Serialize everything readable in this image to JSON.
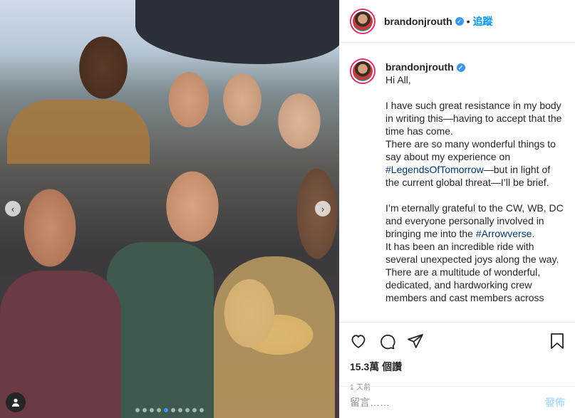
{
  "post": {
    "author": "brandonjrouth",
    "follow_label": "追蹤",
    "separator": "•",
    "verified_icon": "verified-badge-icon",
    "carousel": {
      "total_slides": 10,
      "active_slide": 5,
      "prev_icon": "chevron-left-icon",
      "next_icon": "chevron-right-icon",
      "tag_icon": "user-tag-icon"
    },
    "caption": "Hi All,\n\nI have such great resistance in my body in writing this—having to accept that the time has come.\nThere are so many wonderful things to say about my experience on ",
    "caption_tag1": "#LegendsOfTomorrow",
    "caption_mid": "—but in light of the current global threat—I’ll be brief.\n\nI’m eternally grateful to the CW, WB, DC and everyone personally involved in bringing me into the ",
    "caption_tag2": "#Arrowverse",
    "caption_end": ".\nIt has been an incredible ride with several unexpected joys along the way.\nThere are a multitude of wonderful, dedicated, and hardworking crew members and cast members across",
    "likes": "15.3萬 個讚",
    "time": "1 天前",
    "comment_placeholder": "留言……",
    "post_button": "發佈",
    "icons": {
      "like": "heart-icon",
      "comment": "comment-icon",
      "share": "share-icon",
      "save": "bookmark-icon"
    },
    "colors": {
      "accent": "#0095f6",
      "verified": "#3897f0",
      "post_button_disabled": "#b2dffc"
    }
  }
}
